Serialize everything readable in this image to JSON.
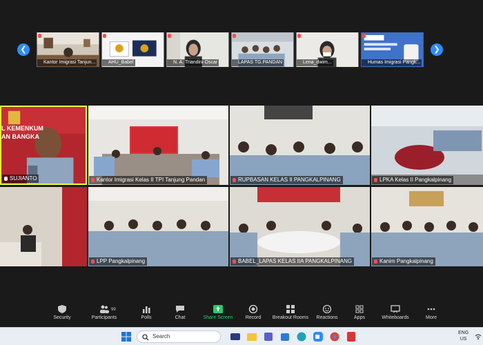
{
  "thumbnails": [
    {
      "name": "Kantor Imigrasi Tanjun..."
    },
    {
      "name": "AHU_Babel"
    },
    {
      "name": "N. A. Triandini Oscar"
    },
    {
      "name": "LAPAS TG.PANDAN"
    },
    {
      "name": "Lena_dwim..."
    },
    {
      "name": "Humas Imigrasi Pangk..."
    }
  ],
  "tiles": [
    {
      "name": "SUJIANTO",
      "banner": "L KEMENKUM",
      "banner2": "AN BANGKA"
    },
    {
      "name": "Kantor Imigrasi Kelas II TPI Tanjung Pandan"
    },
    {
      "name": "RUPBASAN KELAS II PANGKALPINANG"
    },
    {
      "name": "LPKA Kelas II Pangkalpinang"
    },
    {
      "name": ""
    },
    {
      "name": "LPP Pangkalpinang"
    },
    {
      "name": "BABEL_LAPAS KELAS IIA PANGKALPINANG"
    },
    {
      "name": "Kanim Pangkalpinang"
    }
  ],
  "toolbar": {
    "items": [
      {
        "label": "Security",
        "icon": "shield-icon"
      },
      {
        "label": "Participants",
        "icon": "people-icon",
        "count": "99"
      },
      {
        "label": "Polls",
        "icon": "poll-icon"
      },
      {
        "label": "Chat",
        "icon": "chat-icon"
      },
      {
        "label": "Share Screen",
        "icon": "share-screen-icon"
      },
      {
        "label": "Record",
        "icon": "record-icon"
      },
      {
        "label": "Breakout Rooms",
        "icon": "breakout-rooms-icon"
      },
      {
        "label": "Reactions",
        "icon": "reactions-icon"
      },
      {
        "label": "Apps",
        "icon": "apps-icon"
      },
      {
        "label": "Whiteboards",
        "icon": "whiteboard-icon"
      },
      {
        "label": "More",
        "icon": "more-icon"
      }
    ],
    "share_color": "#2fc76c"
  },
  "taskbar": {
    "search_label": "Search",
    "lang_line1": "ENG",
    "lang_line2": "US"
  },
  "colors": {
    "active_border": "#e6ff3a",
    "nav_button": "#2d8cff",
    "background": "#1a1a1a"
  }
}
